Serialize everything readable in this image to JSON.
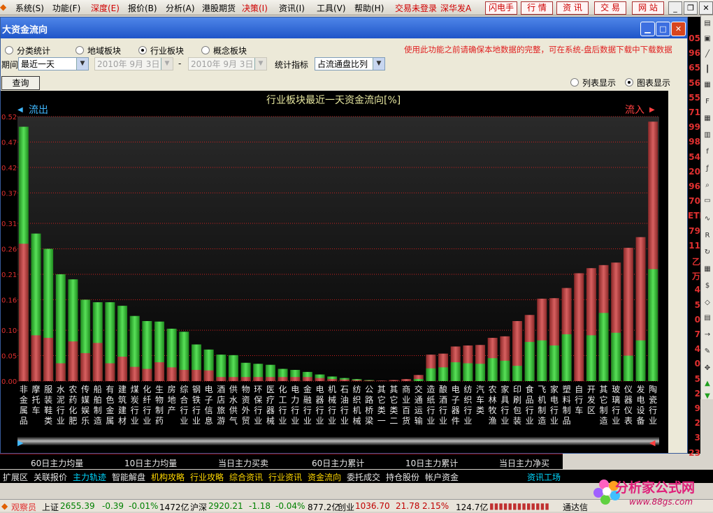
{
  "menubar": {
    "items": [
      "系统(S)",
      "功能(F)",
      "深度(E)",
      "报价(B)",
      "分析(A)",
      "港股期货",
      "决策(I)",
      "资讯(I)",
      "工具(V)",
      "帮助(H)"
    ],
    "status": "交易未登录",
    "market": "深华发A",
    "buttons": [
      "闪电手",
      "行 情",
      "资 讯",
      "交 易",
      "网 站"
    ],
    "win_buttons": [
      "_",
      "❐",
      "✕"
    ]
  },
  "window": {
    "title": "大资金流向",
    "radio_options": [
      "分类统计",
      "地域板块",
      "行业板块",
      "概念板块"
    ],
    "radio_selected": 2,
    "warning": "使用此功能之前请确保本地数据的完整，可在系统-盘后数据下载中下载数据",
    "period_label": "期间",
    "period_value": "最近一天",
    "date_from": "2010年 9月 3日",
    "date_to": "2010年 9月 3日",
    "dash": "-",
    "indicator_label": "统计指标",
    "indicator_value": "占流通盘比列",
    "query_button": "查询",
    "view_options": [
      "列表显示",
      "图表显示"
    ],
    "view_selected": 1
  },
  "colors": {
    "background": "#000000",
    "inflow_red": "#c84848",
    "outflow_green": "#3cc83c",
    "grid": "#cc2020",
    "title": "#e8e8a0",
    "labels": "#e8e8e8",
    "axis": "#e03030",
    "arrow_left": "#40b8ff",
    "arrow_right": "#ff4040"
  },
  "chart_data": {
    "type": "bar",
    "title": "行业板块最近一天资金流向[%]",
    "left_label": "流出",
    "right_label": "流入",
    "ylim": [
      0,
      0.52
    ],
    "y_ticks": [
      "0.52",
      "0.47",
      "0.42",
      "0.37",
      "0.31",
      "0.26",
      "0.21",
      "0.16",
      "0.10",
      "0.05",
      "0.00"
    ],
    "categories": [
      "非金属品",
      "摩托车",
      "服装鞋类",
      "水泥行业",
      "农药化肥",
      "传媒娱乐",
      "船舶制造",
      "有色金属",
      "建筑建材",
      "煤炭行业",
      "化纤行业",
      "生物制药",
      "房地产",
      "综合行业",
      "钢铁行业",
      "电子信息",
      "酒店旅游",
      "供水供气",
      "物资外贸",
      "环保行业",
      "医疗器械",
      "化工行业",
      "电力行业",
      "金融行业",
      "电器行业",
      "机械行业",
      "石油行业",
      "纺织机械",
      "公路桥梁",
      "其它类一",
      "其它类二",
      "商业百货",
      "交通运输",
      "造纸行业",
      "酿酒行业",
      "电子器件",
      "纺织行业",
      "汽车类",
      "农林牧渔",
      "家具行业",
      "印刷包装",
      "食品行业",
      "飞机制造",
      "家电行业",
      "塑料制品",
      "自行车",
      "开发区",
      "其它制造",
      "玻璃行业",
      "仪器仪表",
      "发电设备",
      "陶瓷行业"
    ],
    "series": [
      {
        "name": "outflow",
        "values": [
          0.5,
          0.29,
          0.26,
          0.21,
          0.2,
          0.16,
          0.155,
          0.155,
          0.148,
          0.128,
          0.118,
          0.117,
          0.103,
          0.097,
          0.072,
          0.062,
          0.052,
          0.051,
          0.036,
          0.034,
          0.032,
          0.024,
          0.022,
          0.018,
          0.013,
          0.009,
          0.006,
          0.004,
          0.002,
          0.0,
          0.0,
          0.0,
          0.0,
          0.0,
          0.0,
          0.0,
          0.0,
          0.0,
          0.0,
          0.0,
          0.0,
          0.0,
          0.0,
          0.0,
          0.0,
          0.0,
          0.0,
          0.0,
          0.0,
          0.0,
          0.0,
          0.0
        ]
      },
      {
        "name": "outflow_red_part",
        "values": [
          0.27,
          0.09,
          0.085,
          0.035,
          0.078,
          0.055,
          0.075,
          0.035,
          0.048,
          0.028,
          0.024,
          0.037,
          0.027,
          0.022,
          0.022,
          0.021,
          0.008,
          0.008,
          0.008,
          0.008,
          0.008,
          0.008,
          0.008,
          0.008,
          0.006,
          0.004,
          0.003,
          0.002,
          0.001,
          0.0,
          0.0,
          0.0,
          0.0,
          0.0,
          0.0,
          0.0,
          0.0,
          0.0,
          0.0,
          0.0,
          0.0,
          0.0,
          0.0,
          0.0,
          0.0,
          0.0,
          0.0,
          0.0,
          0.0,
          0.0,
          0.0,
          0.0
        ]
      },
      {
        "name": "inflow",
        "values": [
          0.0,
          0.0,
          0.0,
          0.0,
          0.0,
          0.0,
          0.0,
          0.0,
          0.0,
          0.0,
          0.0,
          0.0,
          0.0,
          0.0,
          0.0,
          0.0,
          0.0,
          0.0,
          0.0,
          0.0,
          0.0,
          0.0,
          0.0,
          0.0,
          0.0,
          0.0,
          0.0,
          0.0,
          0.0,
          0.001,
          0.002,
          0.004,
          0.012,
          0.052,
          0.054,
          0.068,
          0.07,
          0.071,
          0.085,
          0.088,
          0.118,
          0.13,
          0.162,
          0.163,
          0.183,
          0.212,
          0.222,
          0.228,
          0.233,
          0.262,
          0.283,
          0.51
        ]
      },
      {
        "name": "inflow_green_part",
        "values": [
          0.0,
          0.0,
          0.0,
          0.0,
          0.0,
          0.0,
          0.0,
          0.0,
          0.0,
          0.0,
          0.0,
          0.0,
          0.0,
          0.0,
          0.0,
          0.0,
          0.0,
          0.0,
          0.0,
          0.0,
          0.0,
          0.0,
          0.0,
          0.0,
          0.0,
          0.0,
          0.0,
          0.0,
          0.0,
          0.0,
          0.0,
          0.0,
          0.004,
          0.025,
          0.027,
          0.037,
          0.035,
          0.034,
          0.045,
          0.04,
          0.03,
          0.077,
          0.08,
          0.07,
          0.092,
          0.0,
          0.09,
          0.134,
          0.095,
          0.05,
          0.08,
          0.22
        ]
      }
    ],
    "bottom_tabs": [
      "60日主力均量",
      "10日主力均量",
      "当日主力买卖",
      "60日主力累计",
      "10日主力累计",
      "当日主力净买"
    ]
  },
  "bottom_tabs2": [
    "扩展区",
    "关联报价",
    "主力轨迹",
    "智能解盘",
    "机构攻略",
    "行业攻略",
    "综合资讯",
    "行业资讯",
    "资金流向",
    "委托成交",
    "持仓股份",
    "帐户资金",
    "资讯工场"
  ],
  "statusbar": {
    "observer": "观察员",
    "sh_label": "上证",
    "sh_value": "2655.39",
    "sh_change": "-0.39",
    "sh_pct": "-0.01%",
    "sh_amount": "1472亿",
    "hs_label": "沪深",
    "hs_value": "2920.21",
    "hs_change": "-1.18",
    "hs_pct": "-0.04%",
    "hs_amount": "877.2亿",
    "cy_label": "创业",
    "cy_value": "1036.70",
    "cy_change": "21.78",
    "cy_pct": "2.15%",
    "cy_amount": "124.7亿",
    "tail": "通达信"
  },
  "right_numbers": [
    "05",
    "96",
    "65",
    "56",
    "55",
    "71",
    "99",
    "98",
    "54",
    "20",
    "96",
    "70",
    "ETF",
    "79",
    "11",
    "乙",
    "万",
    "4",
    "5",
    "0",
    "7",
    "4",
    "0",
    "5",
    "2",
    "9",
    "2",
    "3",
    "23"
  ],
  "logo": {
    "text": "分析家公式网",
    "url": "www.88gs.com"
  }
}
